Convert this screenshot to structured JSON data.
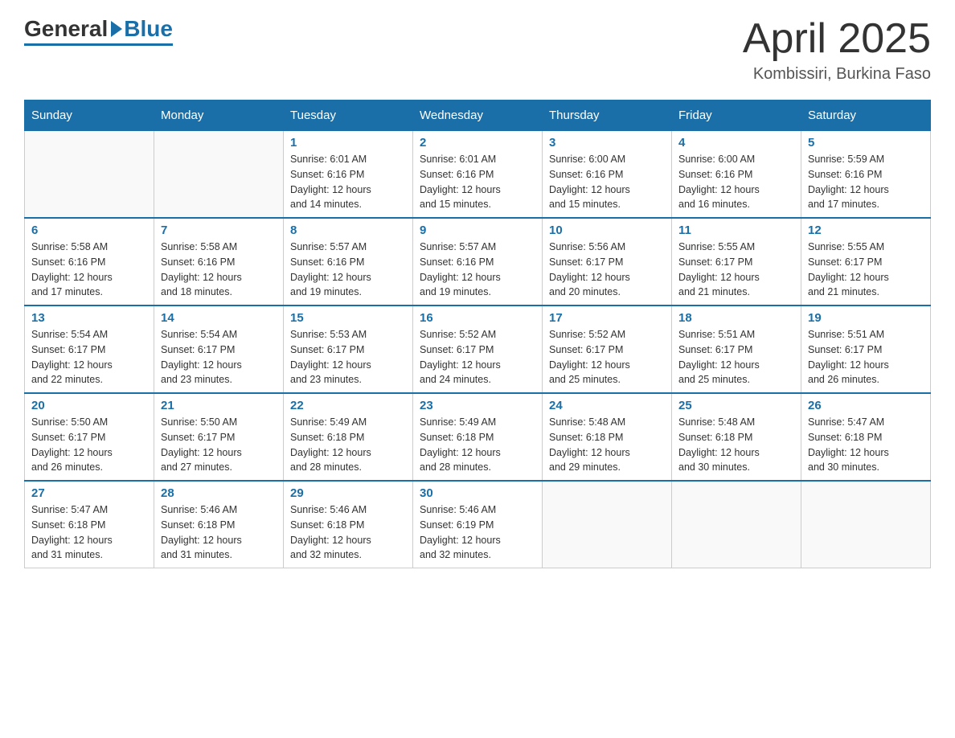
{
  "header": {
    "logo": {
      "general": "General",
      "blue": "Blue"
    },
    "title": "April 2025",
    "location": "Kombissiri, Burkina Faso"
  },
  "days_of_week": [
    "Sunday",
    "Monday",
    "Tuesday",
    "Wednesday",
    "Thursday",
    "Friday",
    "Saturday"
  ],
  "weeks": [
    [
      {
        "day": "",
        "info": ""
      },
      {
        "day": "",
        "info": ""
      },
      {
        "day": "1",
        "info": "Sunrise: 6:01 AM\nSunset: 6:16 PM\nDaylight: 12 hours\nand 14 minutes."
      },
      {
        "day": "2",
        "info": "Sunrise: 6:01 AM\nSunset: 6:16 PM\nDaylight: 12 hours\nand 15 minutes."
      },
      {
        "day": "3",
        "info": "Sunrise: 6:00 AM\nSunset: 6:16 PM\nDaylight: 12 hours\nand 15 minutes."
      },
      {
        "day": "4",
        "info": "Sunrise: 6:00 AM\nSunset: 6:16 PM\nDaylight: 12 hours\nand 16 minutes."
      },
      {
        "day": "5",
        "info": "Sunrise: 5:59 AM\nSunset: 6:16 PM\nDaylight: 12 hours\nand 17 minutes."
      }
    ],
    [
      {
        "day": "6",
        "info": "Sunrise: 5:58 AM\nSunset: 6:16 PM\nDaylight: 12 hours\nand 17 minutes."
      },
      {
        "day": "7",
        "info": "Sunrise: 5:58 AM\nSunset: 6:16 PM\nDaylight: 12 hours\nand 18 minutes."
      },
      {
        "day": "8",
        "info": "Sunrise: 5:57 AM\nSunset: 6:16 PM\nDaylight: 12 hours\nand 19 minutes."
      },
      {
        "day": "9",
        "info": "Sunrise: 5:57 AM\nSunset: 6:16 PM\nDaylight: 12 hours\nand 19 minutes."
      },
      {
        "day": "10",
        "info": "Sunrise: 5:56 AM\nSunset: 6:17 PM\nDaylight: 12 hours\nand 20 minutes."
      },
      {
        "day": "11",
        "info": "Sunrise: 5:55 AM\nSunset: 6:17 PM\nDaylight: 12 hours\nand 21 minutes."
      },
      {
        "day": "12",
        "info": "Sunrise: 5:55 AM\nSunset: 6:17 PM\nDaylight: 12 hours\nand 21 minutes."
      }
    ],
    [
      {
        "day": "13",
        "info": "Sunrise: 5:54 AM\nSunset: 6:17 PM\nDaylight: 12 hours\nand 22 minutes."
      },
      {
        "day": "14",
        "info": "Sunrise: 5:54 AM\nSunset: 6:17 PM\nDaylight: 12 hours\nand 23 minutes."
      },
      {
        "day": "15",
        "info": "Sunrise: 5:53 AM\nSunset: 6:17 PM\nDaylight: 12 hours\nand 23 minutes."
      },
      {
        "day": "16",
        "info": "Sunrise: 5:52 AM\nSunset: 6:17 PM\nDaylight: 12 hours\nand 24 minutes."
      },
      {
        "day": "17",
        "info": "Sunrise: 5:52 AM\nSunset: 6:17 PM\nDaylight: 12 hours\nand 25 minutes."
      },
      {
        "day": "18",
        "info": "Sunrise: 5:51 AM\nSunset: 6:17 PM\nDaylight: 12 hours\nand 25 minutes."
      },
      {
        "day": "19",
        "info": "Sunrise: 5:51 AM\nSunset: 6:17 PM\nDaylight: 12 hours\nand 26 minutes."
      }
    ],
    [
      {
        "day": "20",
        "info": "Sunrise: 5:50 AM\nSunset: 6:17 PM\nDaylight: 12 hours\nand 26 minutes."
      },
      {
        "day": "21",
        "info": "Sunrise: 5:50 AM\nSunset: 6:17 PM\nDaylight: 12 hours\nand 27 minutes."
      },
      {
        "day": "22",
        "info": "Sunrise: 5:49 AM\nSunset: 6:18 PM\nDaylight: 12 hours\nand 28 minutes."
      },
      {
        "day": "23",
        "info": "Sunrise: 5:49 AM\nSunset: 6:18 PM\nDaylight: 12 hours\nand 28 minutes."
      },
      {
        "day": "24",
        "info": "Sunrise: 5:48 AM\nSunset: 6:18 PM\nDaylight: 12 hours\nand 29 minutes."
      },
      {
        "day": "25",
        "info": "Sunrise: 5:48 AM\nSunset: 6:18 PM\nDaylight: 12 hours\nand 30 minutes."
      },
      {
        "day": "26",
        "info": "Sunrise: 5:47 AM\nSunset: 6:18 PM\nDaylight: 12 hours\nand 30 minutes."
      }
    ],
    [
      {
        "day": "27",
        "info": "Sunrise: 5:47 AM\nSunset: 6:18 PM\nDaylight: 12 hours\nand 31 minutes."
      },
      {
        "day": "28",
        "info": "Sunrise: 5:46 AM\nSunset: 6:18 PM\nDaylight: 12 hours\nand 31 minutes."
      },
      {
        "day": "29",
        "info": "Sunrise: 5:46 AM\nSunset: 6:18 PM\nDaylight: 12 hours\nand 32 minutes."
      },
      {
        "day": "30",
        "info": "Sunrise: 5:46 AM\nSunset: 6:19 PM\nDaylight: 12 hours\nand 32 minutes."
      },
      {
        "day": "",
        "info": ""
      },
      {
        "day": "",
        "info": ""
      },
      {
        "day": "",
        "info": ""
      }
    ]
  ]
}
